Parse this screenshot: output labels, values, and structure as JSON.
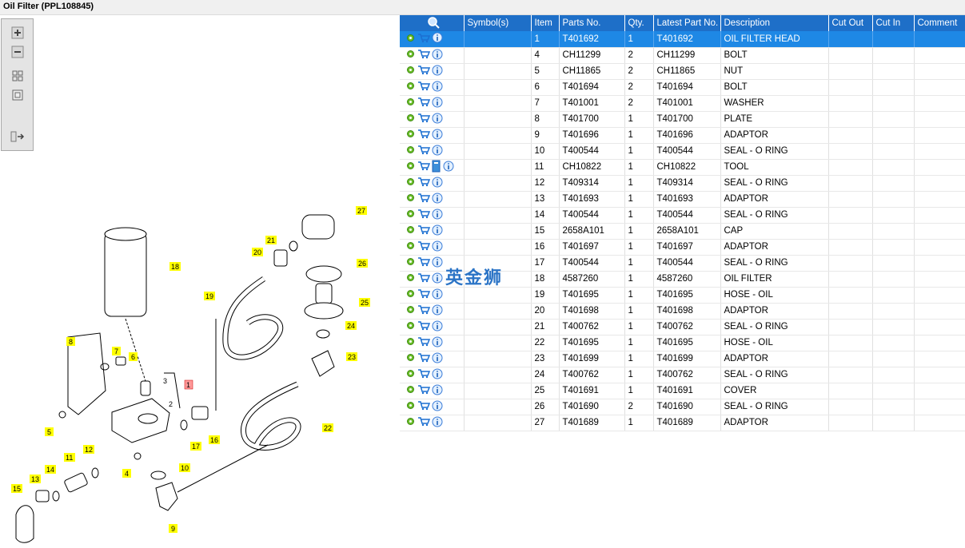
{
  "window": {
    "title": "Oil Filter (PPL108845)"
  },
  "toolbar": {
    "icons": [
      "zoom-in-icon",
      "zoom-out-icon",
      "fit-all-icon",
      "actual-size-icon",
      "expand-list-icon"
    ]
  },
  "watermark": "英金狮",
  "diagram": {
    "callouts": [
      "1",
      "2",
      "3",
      "4",
      "5",
      "6",
      "7",
      "8",
      "9",
      "10",
      "11",
      "12",
      "13",
      "14",
      "15",
      "16",
      "17",
      "18",
      "19",
      "20",
      "21",
      "22",
      "23",
      "24",
      "25",
      "26",
      "27"
    ]
  },
  "grid": {
    "headers": {
      "symbols": "Symbol(s)",
      "item": "Item",
      "parts_no": "Parts No.",
      "qty": "Qty.",
      "latest": "Latest Part No.",
      "description": "Description",
      "cut_out": "Cut Out",
      "cut_in": "Cut In",
      "comment": "Comment"
    },
    "rows": [
      {
        "item": "1",
        "part": "T401692",
        "qty": "1",
        "latest": "T401692",
        "desc": "OIL FILTER HEAD"
      },
      {
        "item": "4",
        "part": "CH11299",
        "qty": "2",
        "latest": "CH11299",
        "desc": "BOLT"
      },
      {
        "item": "5",
        "part": "CH11865",
        "qty": "2",
        "latest": "CH11865",
        "desc": "NUT"
      },
      {
        "item": "6",
        "part": "T401694",
        "qty": "2",
        "latest": "T401694",
        "desc": "BOLT"
      },
      {
        "item": "7",
        "part": "T401001",
        "qty": "2",
        "latest": "T401001",
        "desc": "WASHER"
      },
      {
        "item": "8",
        "part": "T401700",
        "qty": "1",
        "latest": "T401700",
        "desc": "PLATE"
      },
      {
        "item": "9",
        "part": "T401696",
        "qty": "1",
        "latest": "T401696",
        "desc": "ADAPTOR"
      },
      {
        "item": "10",
        "part": "T400544",
        "qty": "1",
        "latest": "T400544",
        "desc": "SEAL - O RING"
      },
      {
        "item": "11",
        "part": "CH10822",
        "qty": "1",
        "latest": "CH10822",
        "desc": "TOOL"
      },
      {
        "item": "12",
        "part": "T409314",
        "qty": "1",
        "latest": "T409314",
        "desc": "SEAL - O RING"
      },
      {
        "item": "13",
        "part": "T401693",
        "qty": "1",
        "latest": "T401693",
        "desc": "ADAPTOR"
      },
      {
        "item": "14",
        "part": "T400544",
        "qty": "1",
        "latest": "T400544",
        "desc": "SEAL - O RING"
      },
      {
        "item": "15",
        "part": "2658A101",
        "qty": "1",
        "latest": "2658A101",
        "desc": "CAP"
      },
      {
        "item": "16",
        "part": "T401697",
        "qty": "1",
        "latest": "T401697",
        "desc": "ADAPTOR"
      },
      {
        "item": "17",
        "part": "T400544",
        "qty": "1",
        "latest": "T400544",
        "desc": "SEAL - O RING"
      },
      {
        "item": "18",
        "part": "4587260",
        "qty": "1",
        "latest": "4587260",
        "desc": "OIL FILTER"
      },
      {
        "item": "19",
        "part": "T401695",
        "qty": "1",
        "latest": "T401695",
        "desc": "HOSE - OIL"
      },
      {
        "item": "20",
        "part": "T401698",
        "qty": "1",
        "latest": "T401698",
        "desc": "ADAPTOR"
      },
      {
        "item": "21",
        "part": "T400762",
        "qty": "1",
        "latest": "T400762",
        "desc": "SEAL - O RING"
      },
      {
        "item": "22",
        "part": "T401695",
        "qty": "1",
        "latest": "T401695",
        "desc": "HOSE - OIL"
      },
      {
        "item": "23",
        "part": "T401699",
        "qty": "1",
        "latest": "T401699",
        "desc": "ADAPTOR"
      },
      {
        "item": "24",
        "part": "T400762",
        "qty": "1",
        "latest": "T400762",
        "desc": "SEAL - O RING"
      },
      {
        "item": "25",
        "part": "T401691",
        "qty": "1",
        "latest": "T401691",
        "desc": "COVER"
      },
      {
        "item": "26",
        "part": "T401690",
        "qty": "2",
        "latest": "T401690",
        "desc": "SEAL - O RING"
      },
      {
        "item": "27",
        "part": "T401689",
        "qty": "1",
        "latest": "T401689",
        "desc": "ADAPTOR"
      }
    ]
  },
  "colors": {
    "header_bg": "#1e6fc8",
    "selected_row": "#1e88e5",
    "callout_bg": "#ffff00",
    "selected_callout": "#ff9999"
  }
}
